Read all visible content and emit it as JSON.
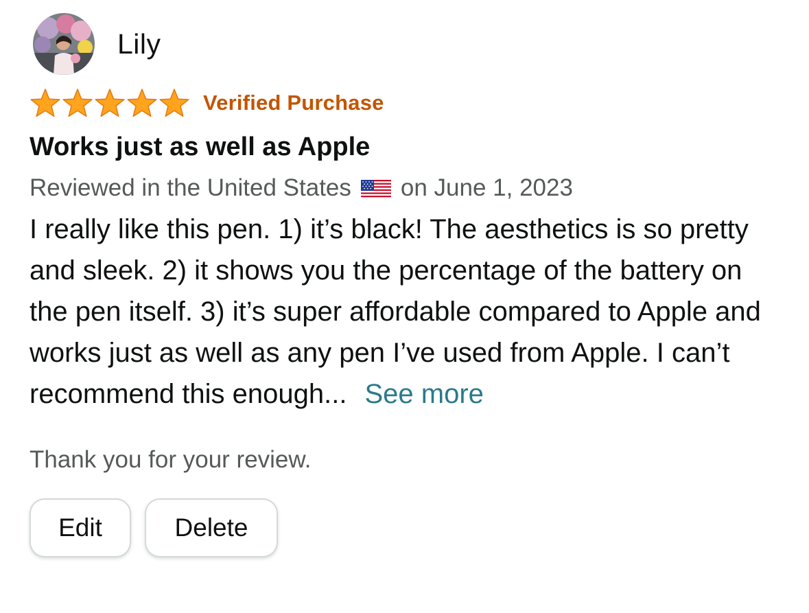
{
  "review": {
    "author": {
      "name": "Lily",
      "avatar_icon": "user-avatar-photo"
    },
    "rating": {
      "stars": 5,
      "max_stars": 5,
      "star_color": "#ffa41c",
      "verified_label": "Verified Purchase",
      "verified_color": "#c45500"
    },
    "title": "Works just as well as Apple",
    "meta": {
      "reviewed_in": "Reviewed in the United States",
      "flag_icon": "us-flag-icon",
      "date": "on June 1, 2023"
    },
    "body": "I really like this pen. 1) it’s black! The aesthetics is so pretty and sleek. 2) it shows you the percentage of the battery on the pen itself. 3) it’s super affordable compared to Apple and works just as well as any pen I’ve used from Apple. I can’t recommend this enough...",
    "see_more_label": "See more",
    "see_more_color": "#2a7a8c",
    "thank_you": "Thank you for your review.",
    "actions": {
      "edit_label": "Edit",
      "delete_label": "Delete"
    }
  }
}
